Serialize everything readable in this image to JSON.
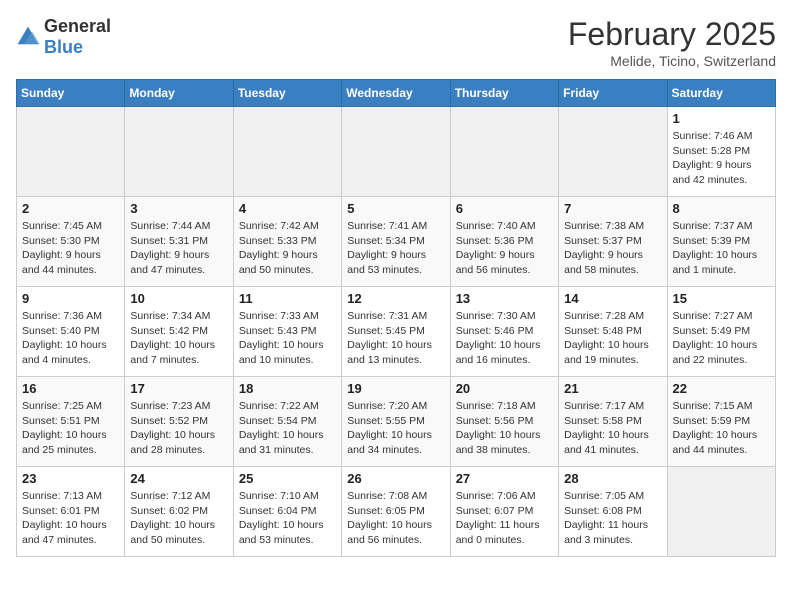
{
  "logo": {
    "text_general": "General",
    "text_blue": "Blue"
  },
  "header": {
    "month_year": "February 2025",
    "location": "Melide, Ticino, Switzerland"
  },
  "weekdays": [
    "Sunday",
    "Monday",
    "Tuesday",
    "Wednesday",
    "Thursday",
    "Friday",
    "Saturday"
  ],
  "weeks": [
    [
      {
        "day": "",
        "sunrise": "",
        "sunset": "",
        "daylight": "",
        "empty": true
      },
      {
        "day": "",
        "sunrise": "",
        "sunset": "",
        "daylight": "",
        "empty": true
      },
      {
        "day": "",
        "sunrise": "",
        "sunset": "",
        "daylight": "",
        "empty": true
      },
      {
        "day": "",
        "sunrise": "",
        "sunset": "",
        "daylight": "",
        "empty": true
      },
      {
        "day": "",
        "sunrise": "",
        "sunset": "",
        "daylight": "",
        "empty": true
      },
      {
        "day": "",
        "sunrise": "",
        "sunset": "",
        "daylight": "",
        "empty": true
      },
      {
        "day": "1",
        "sunrise": "Sunrise: 7:46 AM",
        "sunset": "Sunset: 5:28 PM",
        "daylight": "Daylight: 9 hours and 42 minutes.",
        "empty": false
      }
    ],
    [
      {
        "day": "2",
        "sunrise": "Sunrise: 7:45 AM",
        "sunset": "Sunset: 5:30 PM",
        "daylight": "Daylight: 9 hours and 44 minutes.",
        "empty": false
      },
      {
        "day": "3",
        "sunrise": "Sunrise: 7:44 AM",
        "sunset": "Sunset: 5:31 PM",
        "daylight": "Daylight: 9 hours and 47 minutes.",
        "empty": false
      },
      {
        "day": "4",
        "sunrise": "Sunrise: 7:42 AM",
        "sunset": "Sunset: 5:33 PM",
        "daylight": "Daylight: 9 hours and 50 minutes.",
        "empty": false
      },
      {
        "day": "5",
        "sunrise": "Sunrise: 7:41 AM",
        "sunset": "Sunset: 5:34 PM",
        "daylight": "Daylight: 9 hours and 53 minutes.",
        "empty": false
      },
      {
        "day": "6",
        "sunrise": "Sunrise: 7:40 AM",
        "sunset": "Sunset: 5:36 PM",
        "daylight": "Daylight: 9 hours and 56 minutes.",
        "empty": false
      },
      {
        "day": "7",
        "sunrise": "Sunrise: 7:38 AM",
        "sunset": "Sunset: 5:37 PM",
        "daylight": "Daylight: 9 hours and 58 minutes.",
        "empty": false
      },
      {
        "day": "8",
        "sunrise": "Sunrise: 7:37 AM",
        "sunset": "Sunset: 5:39 PM",
        "daylight": "Daylight: 10 hours and 1 minute.",
        "empty": false
      }
    ],
    [
      {
        "day": "9",
        "sunrise": "Sunrise: 7:36 AM",
        "sunset": "Sunset: 5:40 PM",
        "daylight": "Daylight: 10 hours and 4 minutes.",
        "empty": false
      },
      {
        "day": "10",
        "sunrise": "Sunrise: 7:34 AM",
        "sunset": "Sunset: 5:42 PM",
        "daylight": "Daylight: 10 hours and 7 minutes.",
        "empty": false
      },
      {
        "day": "11",
        "sunrise": "Sunrise: 7:33 AM",
        "sunset": "Sunset: 5:43 PM",
        "daylight": "Daylight: 10 hours and 10 minutes.",
        "empty": false
      },
      {
        "day": "12",
        "sunrise": "Sunrise: 7:31 AM",
        "sunset": "Sunset: 5:45 PM",
        "daylight": "Daylight: 10 hours and 13 minutes.",
        "empty": false
      },
      {
        "day": "13",
        "sunrise": "Sunrise: 7:30 AM",
        "sunset": "Sunset: 5:46 PM",
        "daylight": "Daylight: 10 hours and 16 minutes.",
        "empty": false
      },
      {
        "day": "14",
        "sunrise": "Sunrise: 7:28 AM",
        "sunset": "Sunset: 5:48 PM",
        "daylight": "Daylight: 10 hours and 19 minutes.",
        "empty": false
      },
      {
        "day": "15",
        "sunrise": "Sunrise: 7:27 AM",
        "sunset": "Sunset: 5:49 PM",
        "daylight": "Daylight: 10 hours and 22 minutes.",
        "empty": false
      }
    ],
    [
      {
        "day": "16",
        "sunrise": "Sunrise: 7:25 AM",
        "sunset": "Sunset: 5:51 PM",
        "daylight": "Daylight: 10 hours and 25 minutes.",
        "empty": false
      },
      {
        "day": "17",
        "sunrise": "Sunrise: 7:23 AM",
        "sunset": "Sunset: 5:52 PM",
        "daylight": "Daylight: 10 hours and 28 minutes.",
        "empty": false
      },
      {
        "day": "18",
        "sunrise": "Sunrise: 7:22 AM",
        "sunset": "Sunset: 5:54 PM",
        "daylight": "Daylight: 10 hours and 31 minutes.",
        "empty": false
      },
      {
        "day": "19",
        "sunrise": "Sunrise: 7:20 AM",
        "sunset": "Sunset: 5:55 PM",
        "daylight": "Daylight: 10 hours and 34 minutes.",
        "empty": false
      },
      {
        "day": "20",
        "sunrise": "Sunrise: 7:18 AM",
        "sunset": "Sunset: 5:56 PM",
        "daylight": "Daylight: 10 hours and 38 minutes.",
        "empty": false
      },
      {
        "day": "21",
        "sunrise": "Sunrise: 7:17 AM",
        "sunset": "Sunset: 5:58 PM",
        "daylight": "Daylight: 10 hours and 41 minutes.",
        "empty": false
      },
      {
        "day": "22",
        "sunrise": "Sunrise: 7:15 AM",
        "sunset": "Sunset: 5:59 PM",
        "daylight": "Daylight: 10 hours and 44 minutes.",
        "empty": false
      }
    ],
    [
      {
        "day": "23",
        "sunrise": "Sunrise: 7:13 AM",
        "sunset": "Sunset: 6:01 PM",
        "daylight": "Daylight: 10 hours and 47 minutes.",
        "empty": false
      },
      {
        "day": "24",
        "sunrise": "Sunrise: 7:12 AM",
        "sunset": "Sunset: 6:02 PM",
        "daylight": "Daylight: 10 hours and 50 minutes.",
        "empty": false
      },
      {
        "day": "25",
        "sunrise": "Sunrise: 7:10 AM",
        "sunset": "Sunset: 6:04 PM",
        "daylight": "Daylight: 10 hours and 53 minutes.",
        "empty": false
      },
      {
        "day": "26",
        "sunrise": "Sunrise: 7:08 AM",
        "sunset": "Sunset: 6:05 PM",
        "daylight": "Daylight: 10 hours and 56 minutes.",
        "empty": false
      },
      {
        "day": "27",
        "sunrise": "Sunrise: 7:06 AM",
        "sunset": "Sunset: 6:07 PM",
        "daylight": "Daylight: 11 hours and 0 minutes.",
        "empty": false
      },
      {
        "day": "28",
        "sunrise": "Sunrise: 7:05 AM",
        "sunset": "Sunset: 6:08 PM",
        "daylight": "Daylight: 11 hours and 3 minutes.",
        "empty": false
      },
      {
        "day": "",
        "sunrise": "",
        "sunset": "",
        "daylight": "",
        "empty": true
      }
    ]
  ]
}
